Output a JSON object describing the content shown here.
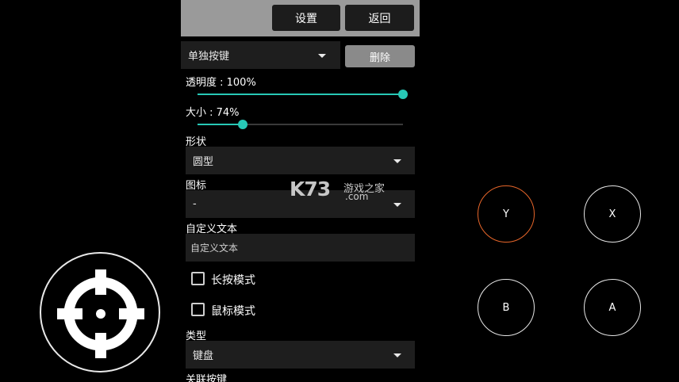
{
  "topbar": {
    "settings_label": "设置",
    "back_label": "返回"
  },
  "mode_select": {
    "value": "单独按键"
  },
  "delete_button": {
    "label": "删除"
  },
  "opacity": {
    "label": "透明度 : 100%",
    "value": 100
  },
  "size": {
    "label": "大小 : 74%",
    "value": 74
  },
  "shape": {
    "label": "形状",
    "value": "圆型"
  },
  "icon_field": {
    "label": "图标",
    "value": "-"
  },
  "custom_text": {
    "label": "自定义文本",
    "value": "自定义文本"
  },
  "long_press": {
    "label": "长按模式",
    "checked": false
  },
  "mouse_mode": {
    "label": "鼠标模式",
    "checked": false
  },
  "type_field": {
    "label": "类型",
    "value": "键盘"
  },
  "bound_key": {
    "label": "关联按键"
  },
  "game_buttons": {
    "y": "Y",
    "x": "X",
    "b": "B",
    "a": "A"
  },
  "watermark": {
    "brand": "K73",
    "site": "游戏之家",
    "domain": ".com"
  },
  "colors": {
    "accent": "#27c8b6",
    "highlight": "#e8662a"
  }
}
